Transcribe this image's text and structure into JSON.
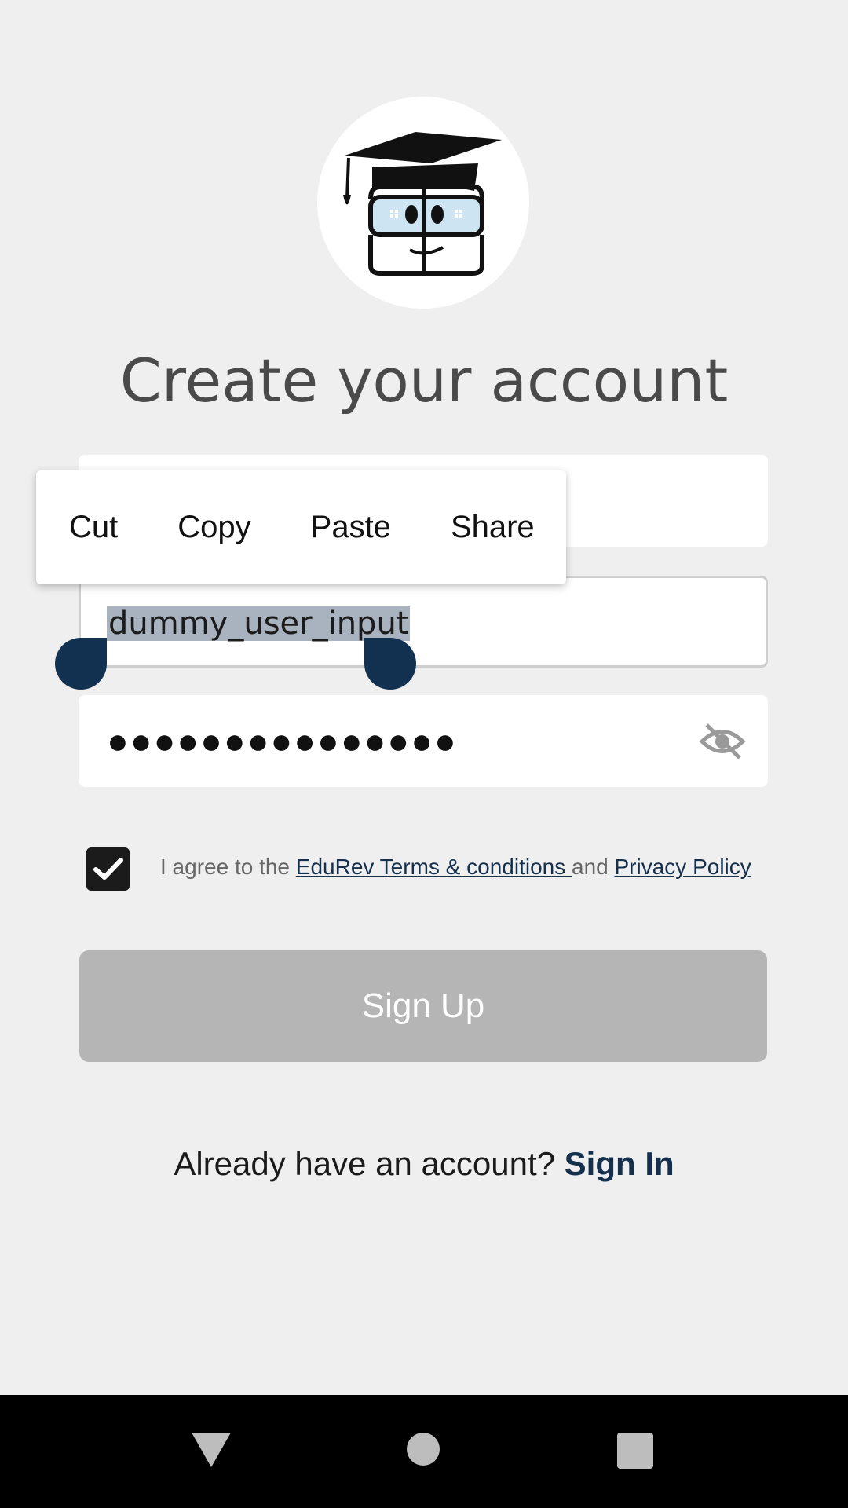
{
  "page_title": "Create your account",
  "fields": {
    "name": {
      "value": ""
    },
    "username": {
      "value": "dummy_user_input"
    },
    "password": {
      "value": "●●●●●●●●●●●●●●●"
    }
  },
  "context_menu": {
    "items": [
      "Cut",
      "Copy",
      "Paste",
      "Share"
    ]
  },
  "agreement": {
    "checked": true,
    "prefix": "I agree to the ",
    "terms_link": "EduRev Terms & conditions ",
    "middle": "and ",
    "privacy_link": "Privacy Policy"
  },
  "signup_button": {
    "label": "Sign Up"
  },
  "signin": {
    "prompt": "Already have an account? ",
    "link": "Sign In"
  },
  "colors": {
    "accent": "#14304d",
    "background": "#efefef",
    "button_disabled": "#b5b5b5"
  },
  "icons": {
    "logo": "edurev-mascot-logo",
    "password_toggle": "eye-off-icon",
    "nav_back": "triangle-back-icon",
    "nav_home": "circle-home-icon",
    "nav_recents": "square-recents-icon"
  }
}
